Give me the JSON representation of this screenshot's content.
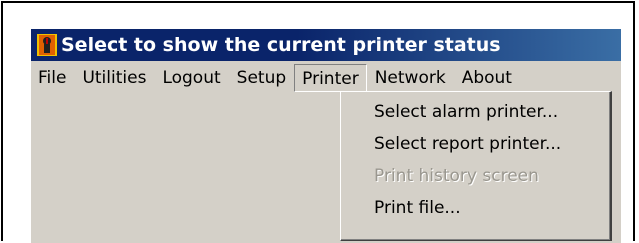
{
  "window": {
    "title": "Select to show the current printer status",
    "title_icon": "printer-status-icon"
  },
  "menubar": {
    "items": [
      "File",
      "Utilities",
      "Logout",
      "Setup",
      "Printer",
      "Network",
      "About"
    ],
    "open_item": "Printer"
  },
  "printer_menu": {
    "items": [
      {
        "label": "Select alarm printer...",
        "enabled": true
      },
      {
        "label": "Select report printer...",
        "enabled": true
      },
      {
        "label": "Print history screen",
        "enabled": false
      },
      {
        "label": "Print file...",
        "enabled": true
      }
    ]
  },
  "colors": {
    "title_bar": "#0a246a",
    "title_text": "#ffffff",
    "menu_background": "#d4d0c8",
    "disabled_text": "#9a978f"
  }
}
